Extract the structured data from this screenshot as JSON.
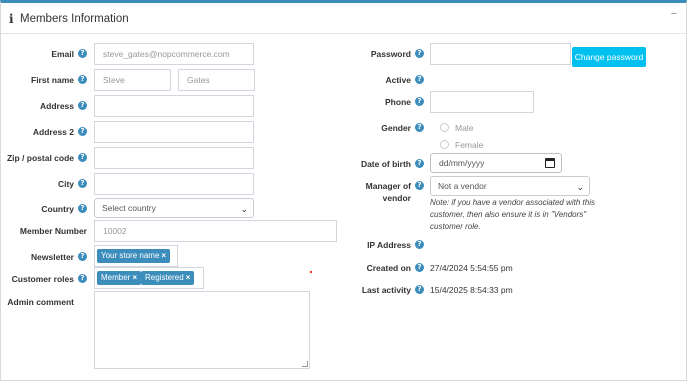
{
  "header": {
    "icon": "info-icon",
    "title": "Members Information",
    "collapse": "−"
  },
  "left": {
    "email": {
      "label": "Email",
      "value": "steve_gates@nopcommerce.com"
    },
    "first_name": {
      "label": "First name",
      "first": "Steve",
      "last": "Gates"
    },
    "address": {
      "label": "Address",
      "value": ""
    },
    "address2": {
      "label": "Address 2",
      "value": ""
    },
    "zip": {
      "label": "Zip / postal code",
      "value": ""
    },
    "city": {
      "label": "City",
      "value": ""
    },
    "country": {
      "label": "Country",
      "selected": "Select country"
    },
    "member_number": {
      "label": "Member Number",
      "value": "10002"
    },
    "newsletter": {
      "label": "Newsletter",
      "tags": [
        "Your store name"
      ]
    },
    "customer_roles": {
      "label": "Customer roles",
      "tags": [
        "Member",
        "Registered"
      ]
    },
    "admin_comment": {
      "label": "Admin comment",
      "value": ""
    }
  },
  "right": {
    "password": {
      "label": "Password",
      "value": "",
      "button": "Change password"
    },
    "active": {
      "label": "Active"
    },
    "phone": {
      "label": "Phone",
      "value": ""
    },
    "gender": {
      "label": "Gender",
      "options": [
        "Male",
        "Female"
      ]
    },
    "dob": {
      "label": "Date of birth",
      "placeholder": "dd/mm/yyyy"
    },
    "manager_of_vendor": {
      "label_line1": "Manager of",
      "label_line2": "vendor",
      "selected": "Not a vendor",
      "note": "Note: if you have a vendor associated with this customer, then also ensure it is in \"Vendors\" customer role."
    },
    "ip_address": {
      "label": "IP Address",
      "value": ""
    },
    "created_on": {
      "label": "Created on",
      "value": "27/4/2024 5:54:55 pm"
    },
    "last_activity": {
      "label": "Last activity",
      "value": "15/4/2025 8:54:33 pm"
    }
  },
  "help_glyph": "?",
  "tag_close": "×",
  "colors": {
    "accent": "#3c8dbc",
    "button": "#00c0ef",
    "border": "#d2d6de"
  }
}
